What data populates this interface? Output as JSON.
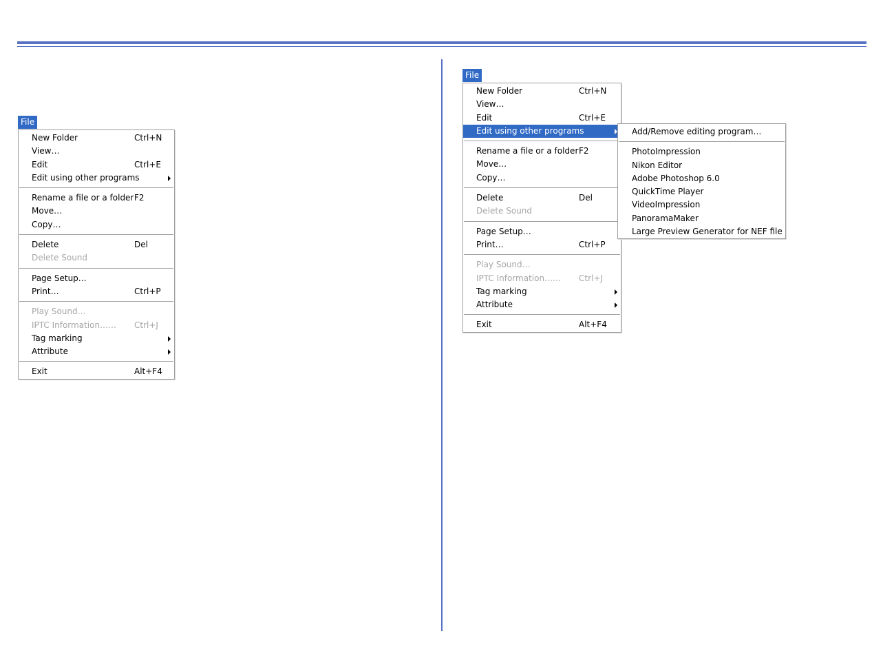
{
  "left": {
    "menu_title": "File",
    "items": [
      {
        "label": "New Folder",
        "shortcut": "Ctrl+N"
      },
      {
        "label": "View…",
        "shortcut": ""
      },
      {
        "label": "Edit",
        "shortcut": "Ctrl+E"
      },
      {
        "label": "Edit using other programs",
        "shortcut": ""
      },
      {
        "label": "Rename a file or a folder",
        "shortcut": "F2"
      },
      {
        "label": "Move…",
        "shortcut": ""
      },
      {
        "label": "Copy…",
        "shortcut": ""
      },
      {
        "label": "Delete",
        "shortcut": "Del"
      },
      {
        "label": "Delete Sound",
        "shortcut": ""
      },
      {
        "label": "Page Setup…",
        "shortcut": ""
      },
      {
        "label": "Print…",
        "shortcut": "Ctrl+P"
      },
      {
        "label": "Play Sound…",
        "shortcut": ""
      },
      {
        "label": "IPTC Information……",
        "shortcut": "Ctrl+J"
      },
      {
        "label": "Tag marking",
        "shortcut": ""
      },
      {
        "label": "Attribute",
        "shortcut": ""
      },
      {
        "label": "Exit",
        "shortcut": "Alt+F4"
      }
    ]
  },
  "right": {
    "menu_title": "File",
    "items": [
      {
        "label": "New Folder",
        "shortcut": "Ctrl+N"
      },
      {
        "label": "View…",
        "shortcut": ""
      },
      {
        "label": "Edit",
        "shortcut": "Ctrl+E"
      },
      {
        "label": "Edit using other programs",
        "shortcut": ""
      },
      {
        "label": "Rename a file or a folder",
        "shortcut": "F2"
      },
      {
        "label": "Move…",
        "shortcut": ""
      },
      {
        "label": "Copy…",
        "shortcut": ""
      },
      {
        "label": "Delete",
        "shortcut": "Del"
      },
      {
        "label": "Delete Sound",
        "shortcut": ""
      },
      {
        "label": "Page Setup…",
        "shortcut": ""
      },
      {
        "label": "Print…",
        "shortcut": "Ctrl+P"
      },
      {
        "label": "Play Sound…",
        "shortcut": ""
      },
      {
        "label": "IPTC Information……",
        "shortcut": "Ctrl+J"
      },
      {
        "label": "Tag marking",
        "shortcut": ""
      },
      {
        "label": "Attribute",
        "shortcut": ""
      },
      {
        "label": "Exit",
        "shortcut": "Alt+F4"
      }
    ],
    "submenu": [
      "Add/Remove editing program…",
      "PhotoImpression",
      "Nikon Editor",
      "Adobe Photoshop 6.0",
      "QuickTime Player",
      "VideoImpression",
      "PanoramaMaker",
      "Large Preview Generator for NEF file"
    ]
  },
  "colors": {
    "accent_rule": "#5b72c4",
    "highlight": "#316ac5",
    "disabled_text": "#a6a6a6"
  }
}
